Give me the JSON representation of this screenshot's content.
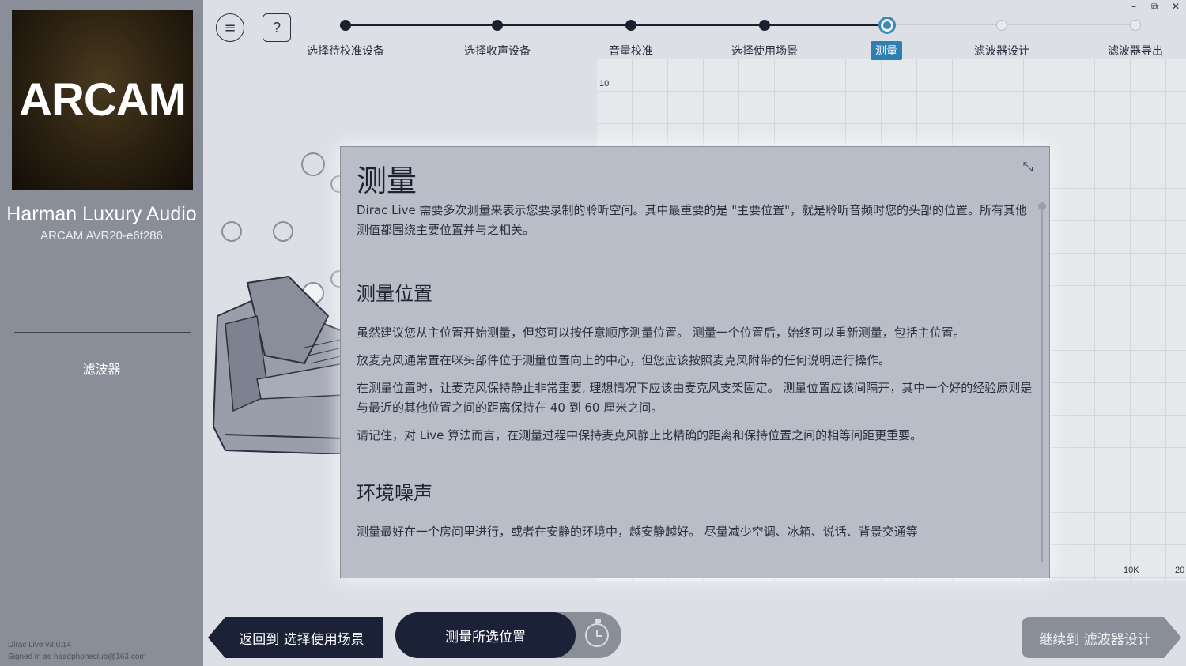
{
  "sidebar": {
    "logo_text": "ARCAM",
    "brand": "Harman Luxury Audio",
    "model": "ARCAM AVR20-e6f286",
    "filter_label": "滤波器",
    "version": "Dirac Live v3.0.14",
    "signed_in": "Signed in as headphoneclub@163.com"
  },
  "toolbar": {
    "menu_icon": "≡",
    "help_icon": "?"
  },
  "stepper": {
    "steps": [
      {
        "label": "选择待校准设备",
        "state": "done"
      },
      {
        "label": "选择收声设备",
        "state": "done"
      },
      {
        "label": "音量校准",
        "state": "done"
      },
      {
        "label": "选择使用场景",
        "state": "done"
      },
      {
        "label": "测量",
        "state": "active"
      },
      {
        "label": "滤波器设计",
        "state": "future"
      },
      {
        "label": "滤波器导出",
        "state": "future"
      }
    ]
  },
  "plot": {
    "y_label_top": "10",
    "x_label_10k": "10K",
    "x_label_20": "20"
  },
  "dialog": {
    "title": "测量",
    "collapse_icon": "⤡",
    "intro": "Dirac Live 需要多次测量来表示您要录制的聆听空间。其中最重要的是 \"主要位置\"，就是聆听音频时您的头部的位置。所有其他测值都围绕主要位置并与之相关。",
    "section1_title": "测量位置",
    "p1": "虽然建议您从主位置开始测量，但您可以按任意顺序测量位置。 测量一个位置后，始终可以重新测量，包括主位置。",
    "p2": "放麦克风通常置在咪头部件位于测量位置向上的中心，但您应该按照麦克风附带的任何说明进行操作。",
    "p3": "在测量位置时，让麦克风保持静止非常重要, 理想情况下应该由麦克风支架固定。 测量位置应该间隔开，其中一个好的经验原则是与最近的其他位置之间的距离保持在 40 到 60 厘米之间。",
    "p4": "请记住，对 Live 算法而言，在测量过程中保持麦克风静止比精确的距离和保持位置之间的相等间距更重要。",
    "section2_title": "环境噪声",
    "p5": "测量最好在一个房间里进行，或者在安静的环境中，越安静越好。 尽量减少空调、冰箱、说话、背景交通等"
  },
  "buttons": {
    "back": "返回到 选择使用场景",
    "measure": "测量所选位置",
    "continue": "继续到 滤波器设计"
  },
  "window": {
    "minimize": "–",
    "restore": "⧉",
    "close": "✕"
  }
}
